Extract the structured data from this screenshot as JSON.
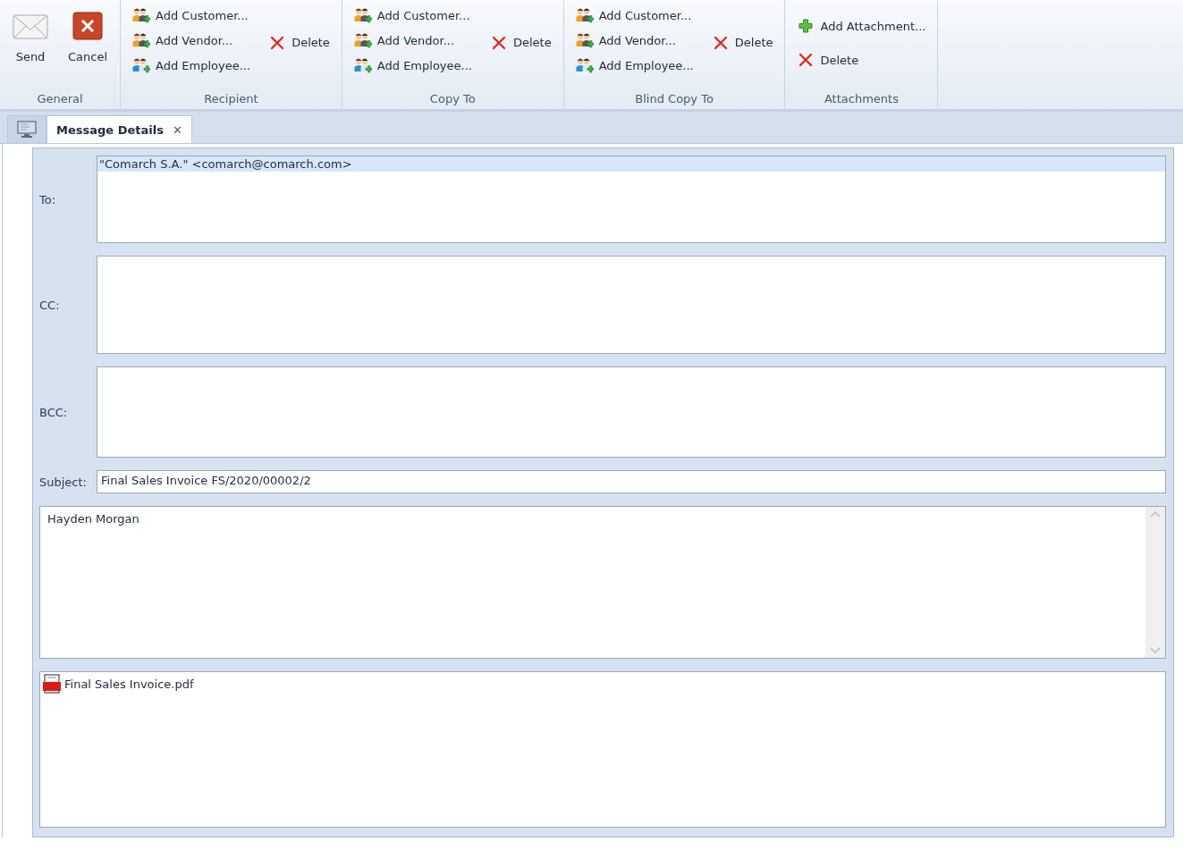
{
  "ribbon": {
    "groups": [
      {
        "label": "General",
        "kind": "large",
        "buttons": [
          {
            "label": "Send",
            "kind": "envelope"
          },
          {
            "label": "Cancel",
            "kind": "cancel"
          }
        ]
      },
      {
        "label": "Recipient",
        "kind": "people",
        "add": [
          {
            "label": "Add Customer...",
            "kind": "customer"
          },
          {
            "label": "Add Vendor...",
            "kind": "vendor"
          },
          {
            "label": "Add Employee...",
            "kind": "employee"
          }
        ],
        "delete": "Delete"
      },
      {
        "label": "Copy To",
        "kind": "people",
        "add": [
          {
            "label": "Add Customer...",
            "kind": "customer"
          },
          {
            "label": "Add Vendor...",
            "kind": "vendor"
          },
          {
            "label": "Add Employee...",
            "kind": "employee"
          }
        ],
        "delete": "Delete"
      },
      {
        "label": "Blind Copy To",
        "kind": "people",
        "add": [
          {
            "label": "Add Customer...",
            "kind": "customer"
          },
          {
            "label": "Add Vendor...",
            "kind": "vendor"
          },
          {
            "label": "Add Employee...",
            "kind": "employee"
          }
        ],
        "delete": "Delete"
      },
      {
        "label": "Attachments",
        "kind": "list",
        "buttons": [
          {
            "label": "Add Attachment...",
            "kind": "plus"
          },
          {
            "label": "Delete",
            "kind": "delete"
          }
        ]
      }
    ]
  },
  "tabs": [
    {
      "kind": "icon",
      "selected": false
    },
    {
      "kind": "text",
      "label": "Message Details",
      "selected": true,
      "close": "✕"
    }
  ],
  "form": {
    "to": {
      "label": "To:",
      "entries": [
        {
          "text": "\"Comarch S.A.\" <comarch@comarch.com>",
          "selected": true
        }
      ]
    },
    "cc": {
      "label": "CC:"
    },
    "bcc": {
      "label": "BCC:"
    },
    "subject": {
      "label": "Subject:",
      "value": "Final Sales Invoice FS/2020/00002/2"
    },
    "body": "Hayden Morgan",
    "attachments": [
      {
        "name": "Final Sales Invoice.pdf",
        "kind": "pdf"
      }
    ]
  }
}
